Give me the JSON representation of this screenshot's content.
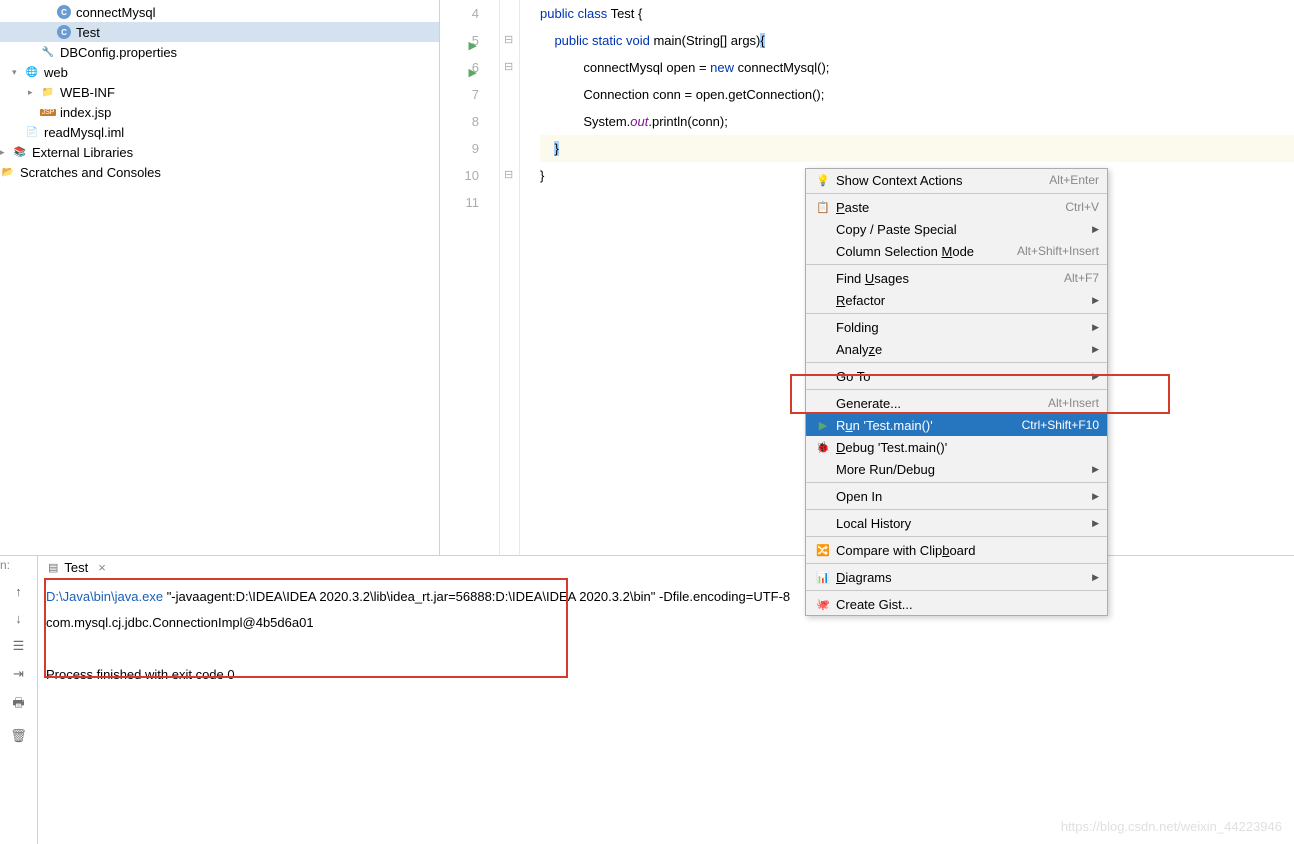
{
  "tree": {
    "connectMysql": "connectMysql",
    "test": "Test",
    "dbconfig": "DBConfig.properties",
    "web": "web",
    "webinf": "WEB-INF",
    "indexjsp": "index.jsp",
    "readmysql": "readMysql.iml",
    "extlib": "External Libraries",
    "scratch": "Scratches and Consoles"
  },
  "editor": {
    "lines": [
      "4",
      "5",
      "6",
      "7",
      "8",
      "9",
      "10",
      "11"
    ],
    "l4": "",
    "l5a": "public class",
    "l5b": " Test {",
    "l6a": "public static void",
    "l6b": " main(String[] args)",
    "l6c": "{",
    "l7a": "            connectMysql open = ",
    "l7b": "new",
    "l7c": " connectMysql();",
    "l8": "            Connection conn = open.getConnection();",
    "l9a": "            System.",
    "l9b": "out",
    "l9c": ".println(conn);",
    "l10": "}",
    "l11": "}"
  },
  "menu": {
    "contextActions": "Show Context Actions",
    "contextActionsKey": "Alt+Enter",
    "paste": "Paste",
    "pasteKey": "Ctrl+V",
    "copySpecial": "Copy / Paste Special",
    "colMode": "Column Selection Mode",
    "colModeKey": "Alt+Shift+Insert",
    "findUsages": "Find Usages",
    "findUsagesKey": "Alt+F7",
    "refactor": "Refactor",
    "folding": "Folding",
    "analyze": "Analyze",
    "goto": "Go To",
    "generate": "Generate...",
    "generateKey": "Alt+Insert",
    "run": "Run 'Test.main()'",
    "runKey": "Ctrl+Shift+F10",
    "debug": "Debug 'Test.main()'",
    "moreRun": "More Run/Debug",
    "openIn": "Open In",
    "localHistory": "Local History",
    "compare": "Compare with Clipboard",
    "diagrams": "Diagrams",
    "gist": "Create Gist..."
  },
  "runTab": "Test",
  "console": {
    "line1a": "D:\\Java\\bin\\java.exe",
    "line1b": " \"-javaagent:D:\\IDEA\\IDEA 2020.3.2\\lib\\idea_rt.jar=56888:D:\\IDEA\\IDEA 2020.3.2\\bin\" -Dfile.encoding=UTF-8",
    "line2": "com.mysql.cj.jdbc.ConnectionImpl@4b5d6a01",
    "line3": "Process finished with exit code 0"
  },
  "watermark": "https://blog.csdn.net/weixin_44223946",
  "labelN": "n:"
}
